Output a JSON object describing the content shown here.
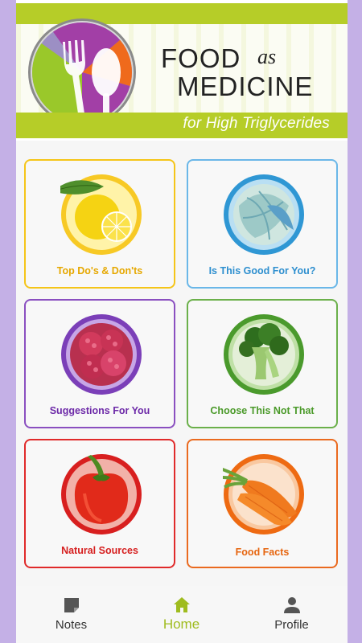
{
  "header": {
    "title_word1": "FOOD",
    "title_word2": "as",
    "title_word3": "MEDICINE",
    "subtitle": "for High Triglycerides"
  },
  "colors": {
    "brand_green": "#b6cd28",
    "card_yellow": "#f5c518",
    "card_blue": "#6ab7e8",
    "card_purple": "#8a4fc0",
    "card_green": "#6bb04a",
    "card_red": "#e02a2a",
    "card_orange": "#ea6a1f"
  },
  "cards": [
    {
      "label": "Top Do's & Don'ts",
      "icon": "lemon-icon"
    },
    {
      "label": "Is This Good For You?",
      "icon": "cabbage-icon"
    },
    {
      "label": "Suggestions For You",
      "icon": "raspberry-icon"
    },
    {
      "label": "Choose This Not That",
      "icon": "broccoli-icon"
    },
    {
      "label": "Natural Sources",
      "icon": "bell-pepper-icon"
    },
    {
      "label": "Food Facts",
      "icon": "carrot-icon"
    }
  ],
  "nav": {
    "items": [
      {
        "label": "Notes",
        "icon": "note-icon"
      },
      {
        "label": "Home",
        "icon": "home-icon",
        "active": true
      },
      {
        "label": "Profile",
        "icon": "person-icon"
      }
    ]
  }
}
